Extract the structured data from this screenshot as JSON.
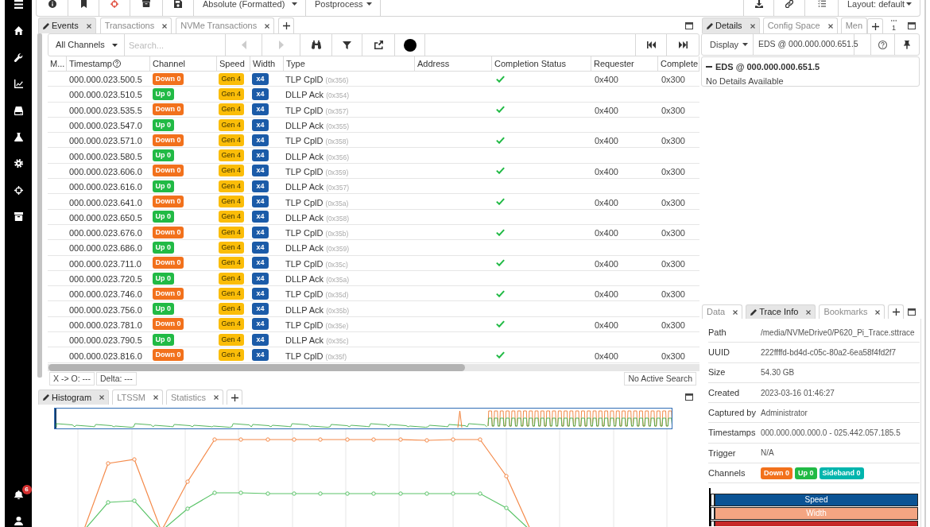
{
  "sidebar": {
    "notification_count": "6"
  },
  "toolbar": {
    "time_format": "Absolute (Formatted)",
    "postprocess": "Postprocess",
    "layout": "Layout: default"
  },
  "main_tabs": [
    {
      "label": "Events",
      "selected": true,
      "closable": true
    },
    {
      "label": "Transactions",
      "selected": false,
      "closable": true
    },
    {
      "label": "NVMe Transactions",
      "selected": false,
      "closable": true
    }
  ],
  "events_toolbar": {
    "channel_filter": "All Channels",
    "search": {
      "placeholder": "Search..."
    },
    "previous": {
      "disabled": true
    },
    "next": {
      "disabled": true
    }
  },
  "table": {
    "columns": [
      "M...",
      "Timestamp",
      "Channel",
      "Speed",
      "Width",
      "Type",
      "Address",
      "Completion Status",
      "Requester",
      "Complete"
    ],
    "rows": [
      {
        "timestamp": "000.000.023.500.5",
        "channel": {
          "label": "Down 0",
          "color": "#f2711c"
        },
        "speed": "Gen 4",
        "width": "x4",
        "type": "TLP CplD",
        "type_code": "(0x356)",
        "completion_ok": true,
        "requester": "0x400",
        "column_10": "0x300"
      },
      {
        "timestamp": "000.000.023.510.5",
        "channel": {
          "label": "Up 0",
          "color": "#21ba45"
        },
        "speed": "Gen 4",
        "width": "x4",
        "type": "DLLP Ack",
        "type_code": "(0x354)",
        "completion_ok": false
      },
      {
        "timestamp": "000.000.023.535.5",
        "channel": {
          "label": "Down 0",
          "color": "#f2711c"
        },
        "speed": "Gen 4",
        "width": "x4",
        "type": "TLP CplD",
        "type_code": "(0x357)",
        "completion_ok": true,
        "requester": "0x400",
        "column_10": "0x300"
      },
      {
        "timestamp": "000.000.023.547.0",
        "channel": {
          "label": "Up 0",
          "color": "#21ba45"
        },
        "speed": "Gen 4",
        "width": "x4",
        "type": "DLLP Ack",
        "type_code": "(0x355)",
        "completion_ok": false
      },
      {
        "timestamp": "000.000.023.571.0",
        "channel": {
          "label": "Down 0",
          "color": "#f2711c"
        },
        "speed": "Gen 4",
        "width": "x4",
        "type": "TLP CplD",
        "type_code": "(0x358)",
        "completion_ok": true,
        "requester": "0x400",
        "column_10": "0x300"
      },
      {
        "timestamp": "000.000.023.580.5",
        "channel": {
          "label": "Up 0",
          "color": "#21ba45"
        },
        "speed": "Gen 4",
        "width": "x4",
        "type": "DLLP Ack",
        "type_code": "(0x356)",
        "completion_ok": false
      },
      {
        "timestamp": "000.000.023.606.0",
        "channel": {
          "label": "Down 0",
          "color": "#f2711c"
        },
        "speed": "Gen 4",
        "width": "x4",
        "type": "TLP CplD",
        "type_code": "(0x359)",
        "completion_ok": true,
        "requester": "0x400",
        "column_10": "0x300"
      },
      {
        "timestamp": "000.000.023.616.0",
        "channel": {
          "label": "Up 0",
          "color": "#21ba45"
        },
        "speed": "Gen 4",
        "width": "x4",
        "type": "DLLP Ack",
        "type_code": "(0x357)",
        "completion_ok": false
      },
      {
        "timestamp": "000.000.023.641.0",
        "channel": {
          "label": "Down 0",
          "color": "#f2711c"
        },
        "speed": "Gen 4",
        "width": "x4",
        "type": "TLP CplD",
        "type_code": "(0x35a)",
        "completion_ok": true,
        "requester": "0x400",
        "column_10": "0x300"
      },
      {
        "timestamp": "000.000.023.650.5",
        "channel": {
          "label": "Up 0",
          "color": "#21ba45"
        },
        "speed": "Gen 4",
        "width": "x4",
        "type": "DLLP Ack",
        "type_code": "(0x358)",
        "completion_ok": false
      },
      {
        "timestamp": "000.000.023.676.0",
        "channel": {
          "label": "Down 0",
          "color": "#f2711c"
        },
        "speed": "Gen 4",
        "width": "x4",
        "type": "TLP CplD",
        "type_code": "(0x35b)",
        "completion_ok": true,
        "requester": "0x400",
        "column_10": "0x300"
      },
      {
        "timestamp": "000.000.023.686.0",
        "channel": {
          "label": "Up 0",
          "color": "#21ba45"
        },
        "speed": "Gen 4",
        "width": "x4",
        "type": "DLLP Ack",
        "type_code": "(0x359)",
        "completion_ok": false
      },
      {
        "timestamp": "000.000.023.711.0",
        "channel": {
          "label": "Down 0",
          "color": "#f2711c"
        },
        "speed": "Gen 4",
        "width": "x4",
        "type": "TLP CplD",
        "type_code": "(0x35c)",
        "completion_ok": true,
        "requester": "0x400",
        "column_10": "0x300"
      },
      {
        "timestamp": "000.000.023.720.5",
        "channel": {
          "label": "Up 0",
          "color": "#21ba45"
        },
        "speed": "Gen 4",
        "width": "x4",
        "type": "DLLP Ack",
        "type_code": "(0x35a)",
        "completion_ok": false
      },
      {
        "timestamp": "000.000.023.746.0",
        "channel": {
          "label": "Down 0",
          "color": "#f2711c"
        },
        "speed": "Gen 4",
        "width": "x4",
        "type": "TLP CplD",
        "type_code": "(0x35d)",
        "completion_ok": true,
        "requester": "0x400",
        "column_10": "0x300"
      },
      {
        "timestamp": "000.000.023.756.0",
        "channel": {
          "label": "Up 0",
          "color": "#21ba45"
        },
        "speed": "Gen 4",
        "width": "x4",
        "type": "DLLP Ack",
        "type_code": "(0x35b)",
        "completion_ok": false
      },
      {
        "timestamp": "000.000.023.781.0",
        "channel": {
          "label": "Down 0",
          "color": "#f2711c"
        },
        "speed": "Gen 4",
        "width": "x4",
        "type": "TLP CplD",
        "type_code": "(0x35e)",
        "completion_ok": true,
        "requester": "0x400",
        "column_10": "0x300"
      },
      {
        "timestamp": "000.000.023.790.5",
        "channel": {
          "label": "Up 0",
          "color": "#21ba45"
        },
        "speed": "Gen 4",
        "width": "x4",
        "type": "DLLP Ack",
        "type_code": "(0x35c)",
        "completion_ok": false
      },
      {
        "timestamp": "000.000.023.816.0",
        "channel": {
          "label": "Down 0",
          "color": "#f2711c"
        },
        "speed": "Gen 4",
        "width": "x4",
        "type": "TLP CplD",
        "type_code": "(0x35f)",
        "completion_ok": true,
        "requester": "0x400",
        "column_10": "0x300"
      }
    ]
  },
  "status_bar": {
    "cursor": "X -> O: ---",
    "delta": "Delta: ---",
    "search_status": "No Active Search"
  },
  "bottom_tabs": [
    {
      "label": "Histogram",
      "selected": true,
      "closable": true
    },
    {
      "label": "LTSSM",
      "selected": false,
      "closable": true
    },
    {
      "label": "Statistics",
      "selected": false,
      "closable": true
    }
  ],
  "right_top_tabs": [
    {
      "label": "Details",
      "selected": true,
      "closable": true
    },
    {
      "label": "Config Space",
      "selected": false,
      "closable": true
    },
    {
      "label": "Men",
      "selected": false,
      "closable": false
    }
  ],
  "tab_overflow_count": "1",
  "details_toolbar": {
    "display": "Display",
    "reference": "EDS @ 000.000.000.651.5"
  },
  "details": {
    "title": "EDS @ 000.000.000.651.5",
    "expanded": true,
    "message": "No Details Available"
  },
  "right_bottom_tabs": [
    {
      "label": "Data",
      "selected": false,
      "closable": true
    },
    {
      "label": "Trace Info",
      "selected": true,
      "closable": true
    },
    {
      "label": "Bookmarks",
      "selected": false,
      "closable": true
    }
  ],
  "trace_info": {
    "fields": [
      {
        "kind": "text",
        "label": "Path",
        "value": "/media/NVMeDrive0/P620_Pi_Trace.sttrace"
      },
      {
        "kind": "text",
        "label": "UUID",
        "value": "222ffffd-bd4d-c05c-80a2-6ea58f4fd2f7"
      },
      {
        "kind": "text",
        "label": "Size",
        "value": "54.30 GB"
      },
      {
        "kind": "text",
        "label": "Created",
        "value": "2023-03-16 01:46:27"
      },
      {
        "kind": "text",
        "label": "Captured by",
        "value": "Administrator"
      },
      {
        "kind": "text",
        "label": "Timestamps",
        "value": "000.000.000.000.0 - 025.442.057.185.5"
      },
      {
        "kind": "text",
        "label": "Trigger",
        "value": "N/A"
      },
      {
        "kind": "badges",
        "label": "Channels",
        "badges": [
          {
            "label": "Down 0",
            "color": "#f2711c"
          },
          {
            "label": "Up 0",
            "color": "#21ba45"
          },
          {
            "label": "Sideband 0",
            "color": "#00b5ad"
          }
        ]
      }
    ]
  },
  "timeline": [
    {
      "label": "Speed",
      "color": "#0b5394"
    },
    {
      "label": "Width",
      "color": "#f4a582"
    },
    {
      "color": "#c62828"
    }
  ]
}
